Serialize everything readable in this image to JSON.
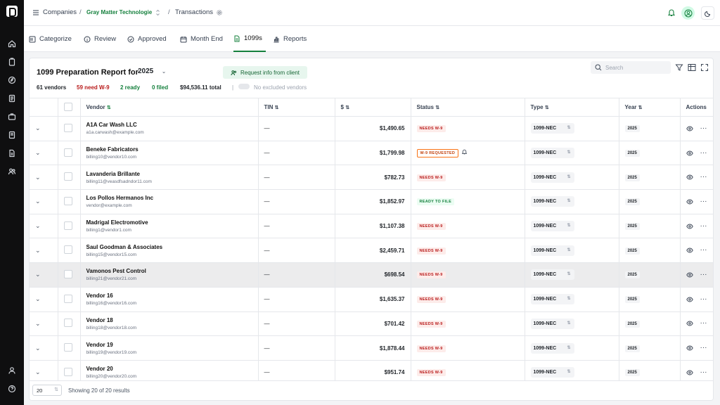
{
  "breadcrumb": {
    "companies": "Companies",
    "sep1": "/",
    "org": "Gray Matter Technologie",
    "sep2": "/",
    "page": "Transactions"
  },
  "tabs": [
    {
      "label": "Categorize",
      "icon": "categorize-icon"
    },
    {
      "label": "Review",
      "icon": "info-icon"
    },
    {
      "label": "Approved",
      "icon": "check-circle-icon"
    },
    {
      "label": "Month End",
      "icon": "calendar-icon"
    },
    {
      "label": "1099s",
      "icon": "document-icon",
      "active": true
    },
    {
      "label": "Reports",
      "icon": "bar-chart-icon"
    }
  ],
  "report": {
    "title": "1099 Preparation Report for",
    "year": "2025",
    "request_button": "Request info from client",
    "search_placeholder": "Search",
    "stats": {
      "vendors": "61 vendors",
      "need_w9": "59 need W-9",
      "ready": "2 ready",
      "filed": "0 filed",
      "total": "$94,536.11 total",
      "divider": "|",
      "excluded": "No excluded vendors"
    }
  },
  "columns": {
    "vendor": "Vendor",
    "tin": "TIN",
    "amount": "$",
    "status": "Status",
    "type": "Type",
    "year": "Year",
    "actions": "Actions"
  },
  "rows": [
    {
      "name": "A1A Car Wash LLC",
      "email": "a1a.carwash@example.com",
      "tin": "—",
      "amount": "$1,490.65",
      "status": "NEEDS W-9",
      "status_kind": "need",
      "type": "1099-NEC",
      "year": "2025"
    },
    {
      "name": "Beneke Fabricators",
      "email": "billing10@vendor10.com",
      "tin": "—",
      "amount": "$1,799.98",
      "status": "W-9 REQUESTED",
      "status_kind": "req",
      "type": "1099-NEC",
      "year": "2025"
    },
    {
      "name": "Lavanderia Brillante",
      "email": "billing11@veasdfsadndor11.com",
      "tin": "—",
      "amount": "$782.73",
      "status": "NEEDS W-9",
      "status_kind": "need",
      "type": "1099-NEC",
      "year": "2025"
    },
    {
      "name": "Los Pollos Hermanos Inc",
      "email": "vendor@example.com",
      "tin": "—",
      "amount": "$1,852.97",
      "status": "READY TO FILE",
      "status_kind": "ready",
      "type": "1099-NEC",
      "year": "2025"
    },
    {
      "name": "Madrigal Electromotive",
      "email": "billing1@vendor1.com",
      "tin": "—",
      "amount": "$1,107.38",
      "status": "NEEDS W-9",
      "status_kind": "need",
      "type": "1099-NEC",
      "year": "2025"
    },
    {
      "name": "Saul Goodman & Associates",
      "email": "billing15@vendor15.com",
      "tin": "—",
      "amount": "$2,459.71",
      "status": "NEEDS W-9",
      "status_kind": "need",
      "type": "1099-NEC",
      "year": "2025"
    },
    {
      "name": "Vamonos Pest Control",
      "email": "billing21@vendor21.com",
      "tin": "—",
      "amount": "$698.54",
      "status": "NEEDS W-9",
      "status_kind": "need",
      "type": "1099-NEC",
      "year": "2025",
      "highlight": true
    },
    {
      "name": "Vendor 16",
      "email": "billing16@vendor16.com",
      "tin": "—",
      "amount": "$1,635.37",
      "status": "NEEDS W-9",
      "status_kind": "need",
      "type": "1099-NEC",
      "year": "2025"
    },
    {
      "name": "Vendor 18",
      "email": "billing18@vendor18.com",
      "tin": "—",
      "amount": "$701.42",
      "status": "NEEDS W-9",
      "status_kind": "need",
      "type": "1099-NEC",
      "year": "2025"
    },
    {
      "name": "Vendor 19",
      "email": "billing19@vendor19.com",
      "tin": "—",
      "amount": "$1,878.44",
      "status": "NEEDS W-9",
      "status_kind": "need",
      "type": "1099-NEC",
      "year": "2025"
    },
    {
      "name": "Vendor 20",
      "email": "billing20@vendor20.com",
      "tin": "—",
      "amount": "$951.74",
      "status": "NEEDS W-9",
      "status_kind": "need",
      "type": "1099-NEC",
      "year": "2025"
    }
  ],
  "footer": {
    "per_page": "20",
    "showing": "Showing 20 of 20 results"
  },
  "colors": {
    "accent": "#15803d",
    "need": "#b91c1c",
    "requested": "#c2410c",
    "sidebar": "#0f0f10"
  }
}
